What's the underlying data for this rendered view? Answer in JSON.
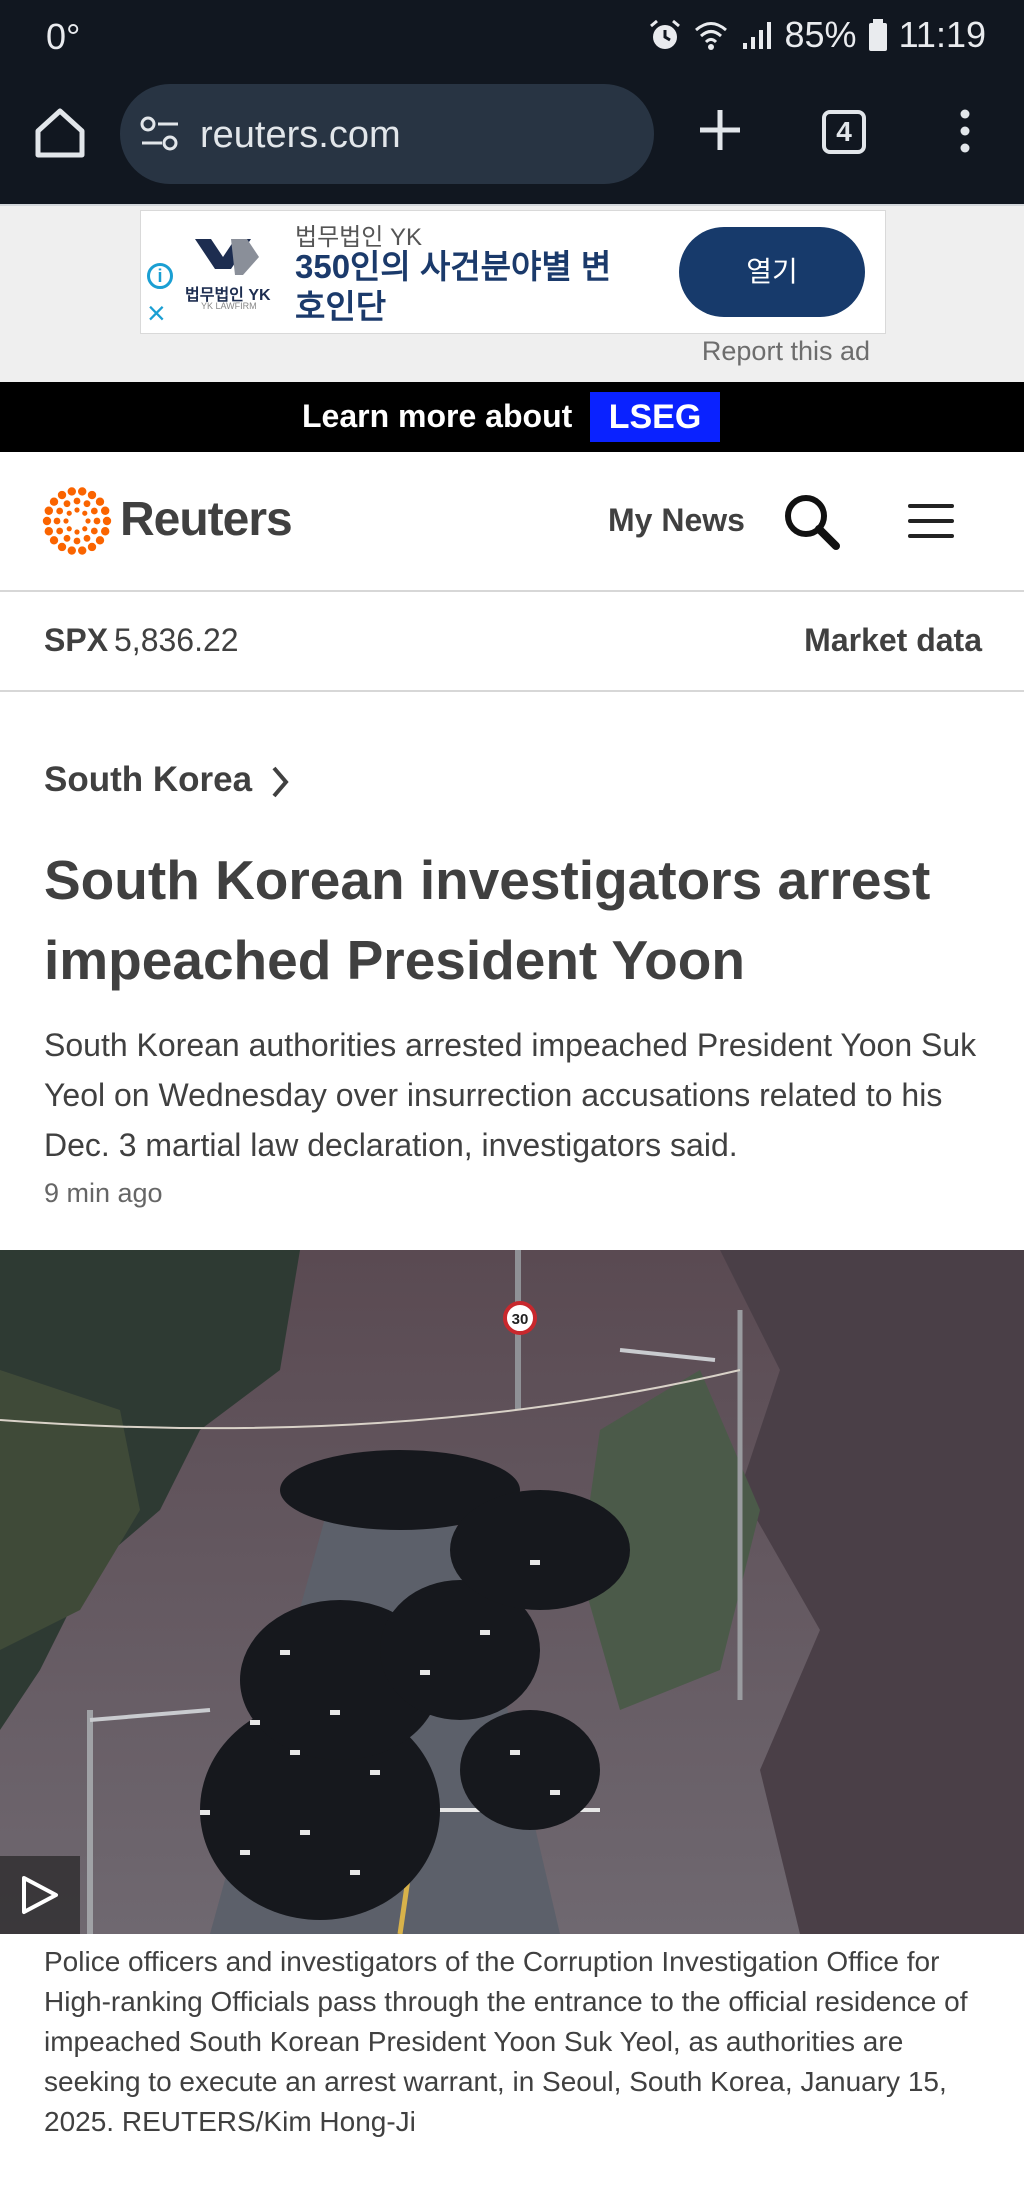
{
  "status_bar": {
    "temperature": "0°",
    "battery": "85%",
    "time": "11:19"
  },
  "browser": {
    "url": "reuters.com",
    "tab_count": "4"
  },
  "ad": {
    "brand_small": "법무법인 YK",
    "headline": "350인의 사건분야별 변호인단",
    "logo_text": "법무법인 YK",
    "logo_subtext": "YK LAWFIRM",
    "cta": "열기",
    "report_label": "Report this ad"
  },
  "promo": {
    "text": "Learn more about",
    "badge": "LSEG"
  },
  "header": {
    "brand": "Reuters",
    "my_news": "My News"
  },
  "market": {
    "symbol": "SPX",
    "value": "5,836.22",
    "link": "Market data"
  },
  "article": {
    "section": "South Korea",
    "headline": "South Korean investigators arrest impeached President Yoon",
    "summary": "South Korean authorities arrested impeached President Yoon Suk Yeol on Wednesday over insurrection accusations related to his Dec. 3 martial law declaration, investigators said.",
    "time": "9 min ago",
    "speed_sign": "30",
    "caption": "Police officers and investigators of the Corruption Investigation Office for High-ranking Officials pass through the entrance to the official residence of impeached South Korean President Yoon Suk Yeol, as authorities are seeking to execute an arrest warrant, in Seoul, South Korea, January 15, 2025. REUTERS/Kim Hong-Ji"
  },
  "colors": {
    "chrome_bg": "#111720",
    "url_bar": "#283443",
    "ad_cta": "#173a6b",
    "lseg_blue": "#0a22ff",
    "reuters_orange": "#fa6400",
    "text": "#404040"
  },
  "icons": [
    "alarm-icon",
    "wifi-icon",
    "signal-icon",
    "battery-icon",
    "home-icon",
    "tune-icon",
    "plus-icon",
    "tabs-icon",
    "more-vert-icon",
    "info-icon",
    "close-icon",
    "search-icon",
    "menu-icon",
    "chevron-right-icon",
    "play-icon"
  ]
}
